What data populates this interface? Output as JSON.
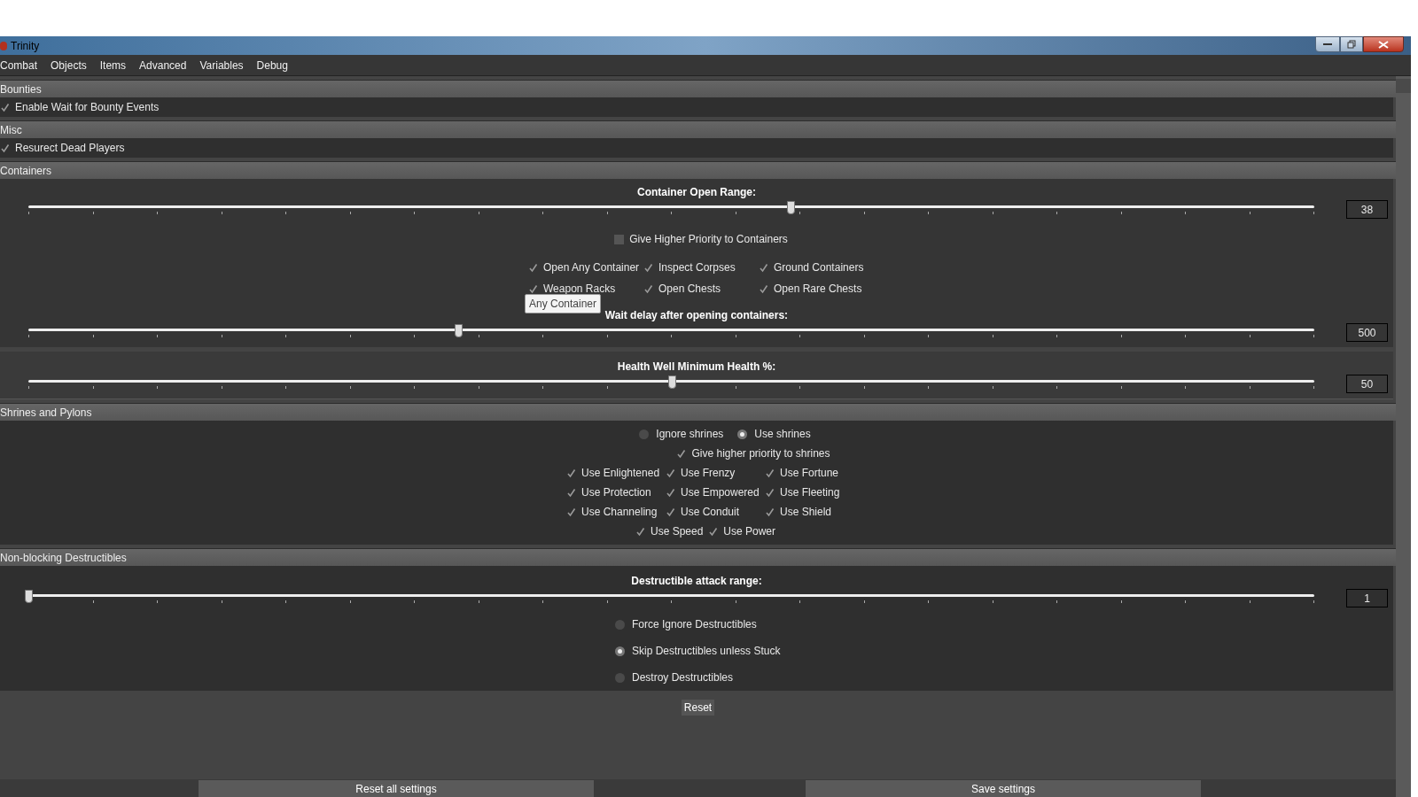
{
  "window": {
    "title": "Trinity"
  },
  "menu": [
    "Combat",
    "Objects",
    "Items",
    "Advanced",
    "Variables",
    "Debug"
  ],
  "bounties": {
    "header": "Bounties",
    "checkbox": {
      "label": "Enable Wait for Bounty Events",
      "checked": true
    }
  },
  "misc": {
    "header": "Misc",
    "checkbox": {
      "label": "Resurect Dead Players",
      "checked": true
    }
  },
  "containers": {
    "header": "Containers",
    "open_range_slider": {
      "label": "Container Open Range:",
      "level": 0.593,
      "value": "38"
    },
    "priority_checkbox": {
      "label": "Give Higher Priority to Containers",
      "checked": false
    },
    "checkbox_rows": [
      [
        {
          "label": "Open Any Container",
          "checked": true
        },
        {
          "label": "Inspect Corpses",
          "checked": true
        },
        {
          "label": "Ground Containers",
          "checked": true
        }
      ],
      [
        {
          "label": "Weapon Racks",
          "checked": true
        },
        {
          "label": "Open Chests",
          "checked": true
        },
        {
          "label": "Open Rare Chests",
          "checked": true
        }
      ]
    ],
    "tooltip": "Any Container",
    "wait_delay_slider": {
      "label": "Wait delay after opening containers:",
      "level": 0.334,
      "value": "500"
    },
    "health_well_slider": {
      "label": "Health Well Minimum Health %:",
      "level": 0.5,
      "value": "50"
    }
  },
  "shrines": {
    "header": "Shrines and Pylons",
    "radios": [
      {
        "label": "Ignore shrines",
        "selected": false
      },
      {
        "label": "Use shrines",
        "selected": true
      }
    ],
    "priority_checkbox": {
      "label": "Give higher priority to shrines",
      "checked": true
    },
    "checkbox_rows": [
      [
        {
          "label": "Use Enlightened",
          "checked": true
        },
        {
          "label": "Use Frenzy",
          "checked": true
        },
        {
          "label": "Use Fortune",
          "checked": true
        }
      ],
      [
        {
          "label": "Use Protection",
          "checked": true
        },
        {
          "label": "Use Empowered",
          "checked": true
        },
        {
          "label": "Use Fleeting",
          "checked": true
        }
      ],
      [
        {
          "label": "Use Channeling",
          "checked": true
        },
        {
          "label": "Use Conduit",
          "checked": true
        },
        {
          "label": "Use Shield",
          "checked": true
        }
      ],
      [
        {
          "label": "Use Speed",
          "checked": true
        },
        {
          "label": "Use Power",
          "checked": true
        }
      ]
    ]
  },
  "destructibles": {
    "header": "Non-blocking Destructibles",
    "slider": {
      "label": "Destructible attack range:",
      "level": 0,
      "value": "1"
    },
    "radios": [
      {
        "label": "Force Ignore Destructibles",
        "selected": false
      },
      {
        "label": "Skip Destructibles unless Stuck",
        "selected": true
      },
      {
        "label": "Destroy Destructibles",
        "selected": false
      }
    ]
  },
  "reset_button": "Reset",
  "footer_buttons": [
    "Reset all settings",
    "Save settings"
  ]
}
